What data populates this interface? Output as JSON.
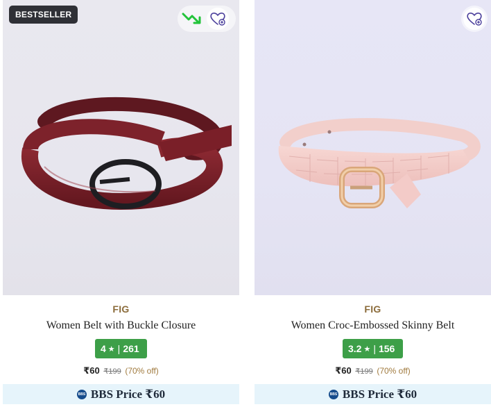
{
  "products": [
    {
      "badge": "BESTSELLER",
      "brand": "FIG",
      "name": "Women Belt with Buckle Closure",
      "rating": "4",
      "reviews": "261",
      "price": "₹60",
      "mrp": "₹199",
      "discount": "(70% off)",
      "bbs_price": "BBS Price ₹60",
      "icons": [
        "trending-down-icon",
        "wishlist-heart-icon"
      ],
      "belt_color": "#7a1f28"
    },
    {
      "brand": "FIG",
      "name": "Women Croc-Embossed Skinny Belt",
      "rating": "3.2",
      "reviews": "156",
      "price": "₹60",
      "mrp": "₹199",
      "discount": "(70% off)",
      "bbs_price": "BBS Price ₹60",
      "icons": [
        "wishlist-heart-icon"
      ],
      "belt_color": "#f3cbc8"
    }
  ],
  "rating_separator": "|",
  "star_glyph": "★",
  "bbs_logo_text": "BBS",
  "colors": {
    "rating_green": "#3d9f48",
    "brand_gold": "#8b6c3b",
    "bbs_bg": "#e6f4fb",
    "trend_green": "#22c33a",
    "heart_purple": "#4b3f9c"
  }
}
